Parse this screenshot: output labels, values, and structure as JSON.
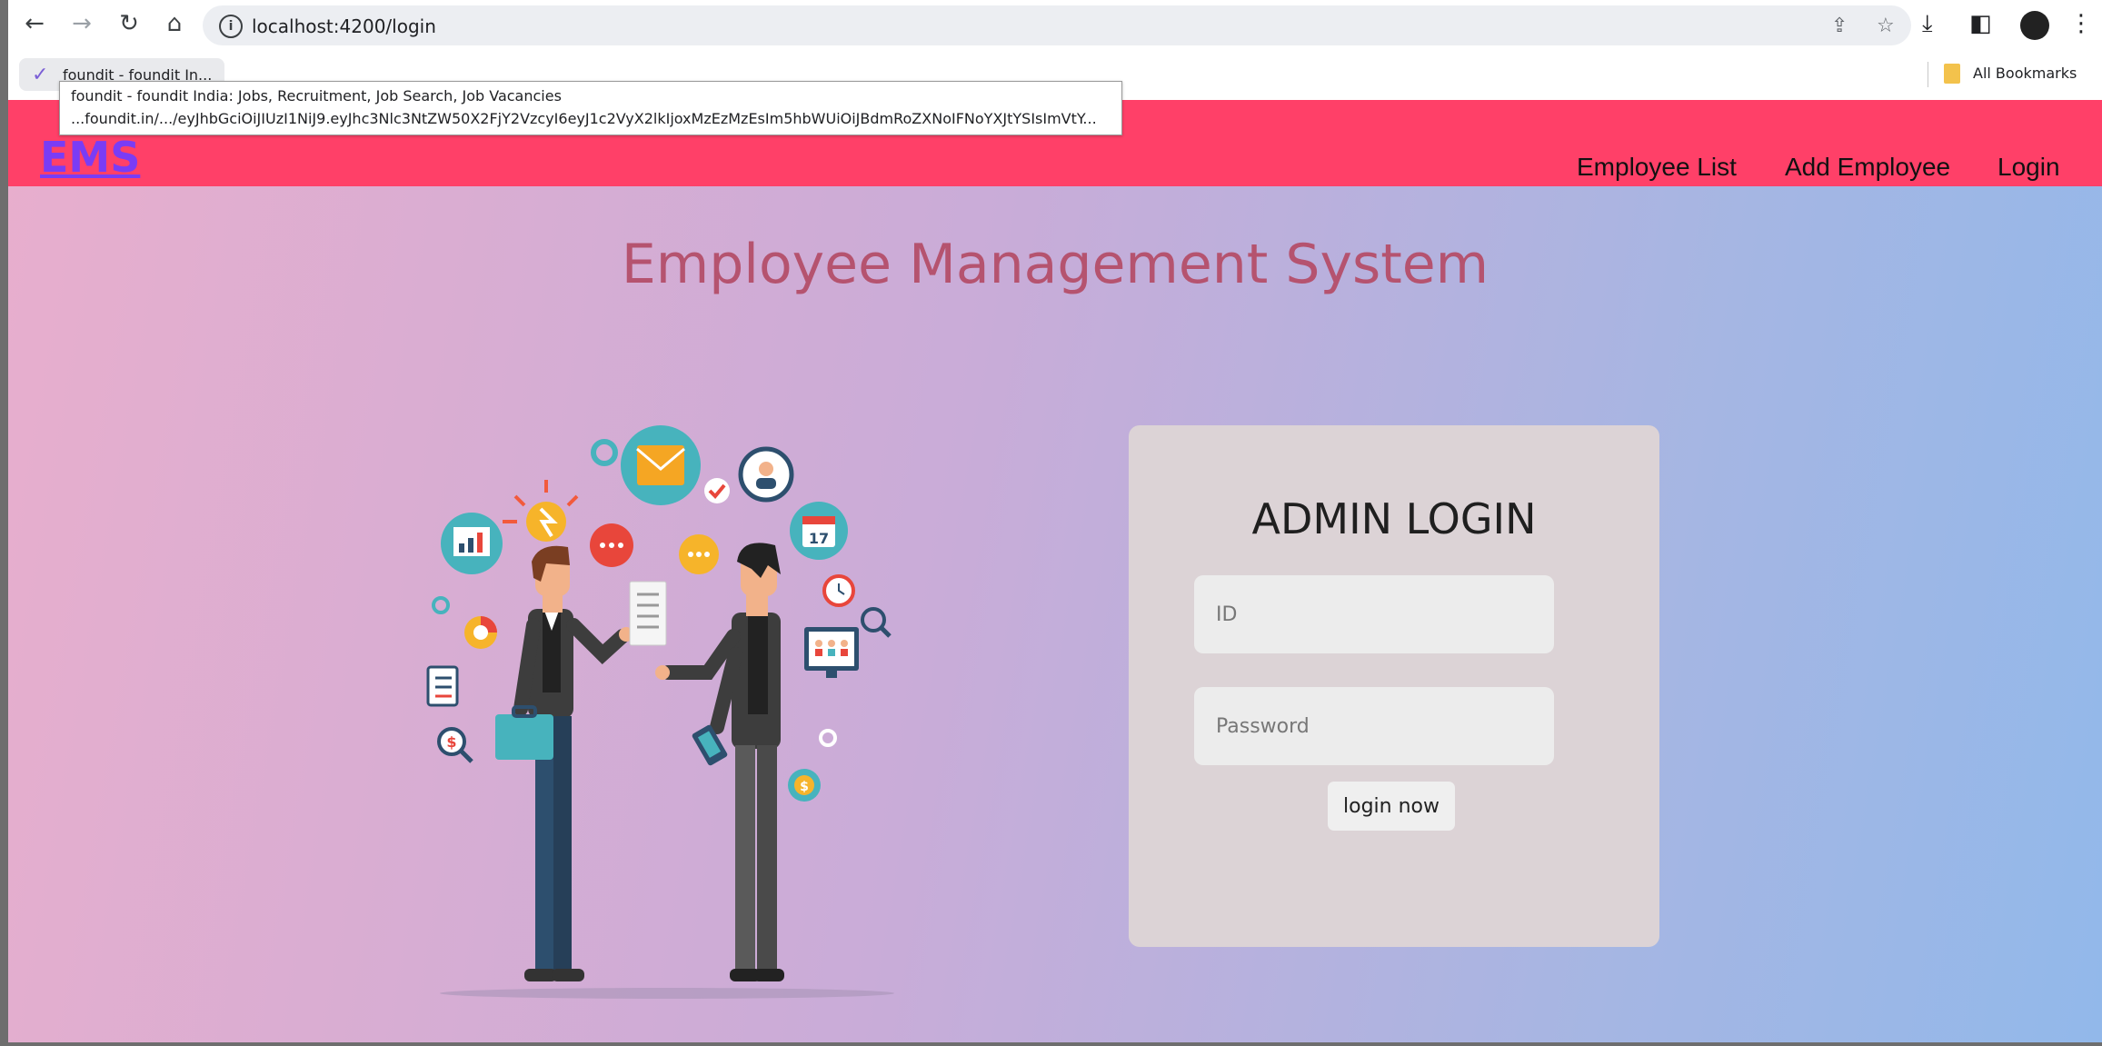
{
  "browser": {
    "url": "localhost:4200/login",
    "bookmark_tab_label": "foundit - foundit In...",
    "bookmarks_label": "All Bookmarks",
    "tooltip_title": "foundit - foundit India: Jobs, Recruitment, Job Search, Job Vacancies",
    "tooltip_url": "...foundit.in/.../eyJhbGciOiJIUzI1NiJ9.eyJhc3Nlc3NtZW50X2FjY2VzcyI6eyJ1c2VyX2lkIjoxMzEzMzEsIm5hbWUiOiJBdmRoZXNoIFNoYXJtYSIsImVtY...",
    "icons": [
      "back-arrow-icon",
      "forward-arrow-icon",
      "reload-icon",
      "home-icon",
      "info-icon",
      "share-icon",
      "star-icon",
      "download-icon",
      "sidepanel-icon",
      "profile-avatar",
      "menu-kebab-icon",
      "folder-icon"
    ]
  },
  "app": {
    "brand": "EMS",
    "nav": [
      {
        "label": "Employee List"
      },
      {
        "label": "Add Employee"
      },
      {
        "label": "Login"
      }
    ],
    "page_title": "Employee Management System",
    "colors": {
      "appbar": "#ff4068",
      "brand": "#7a3cf5",
      "title": "#b5536f",
      "card": "#dcd3d6"
    }
  },
  "login": {
    "title": "ADMIN LOGIN",
    "id_placeholder": "ID",
    "password_placeholder": "Password",
    "button_label": "login now"
  }
}
